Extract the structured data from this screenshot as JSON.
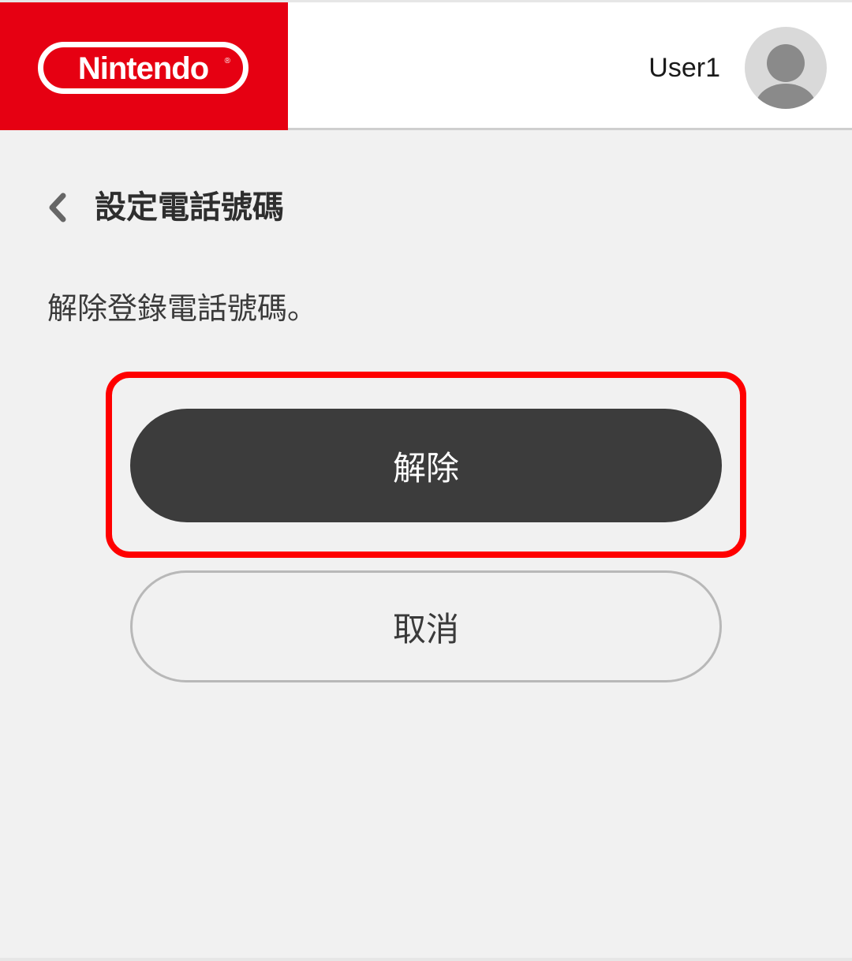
{
  "header": {
    "logo_text": "Nintendo",
    "logo_registered": "®",
    "username": "User1",
    "brand_color": "#e60012",
    "avatar_icon": "user-silhouette-icon"
  },
  "page": {
    "back_icon": "chevron-left-icon",
    "title": "設定電話號碼",
    "description": "解除登錄電話號碼。"
  },
  "actions": {
    "confirm_label": "解除",
    "cancel_label": "取消",
    "highlight_color": "#ff0000"
  }
}
